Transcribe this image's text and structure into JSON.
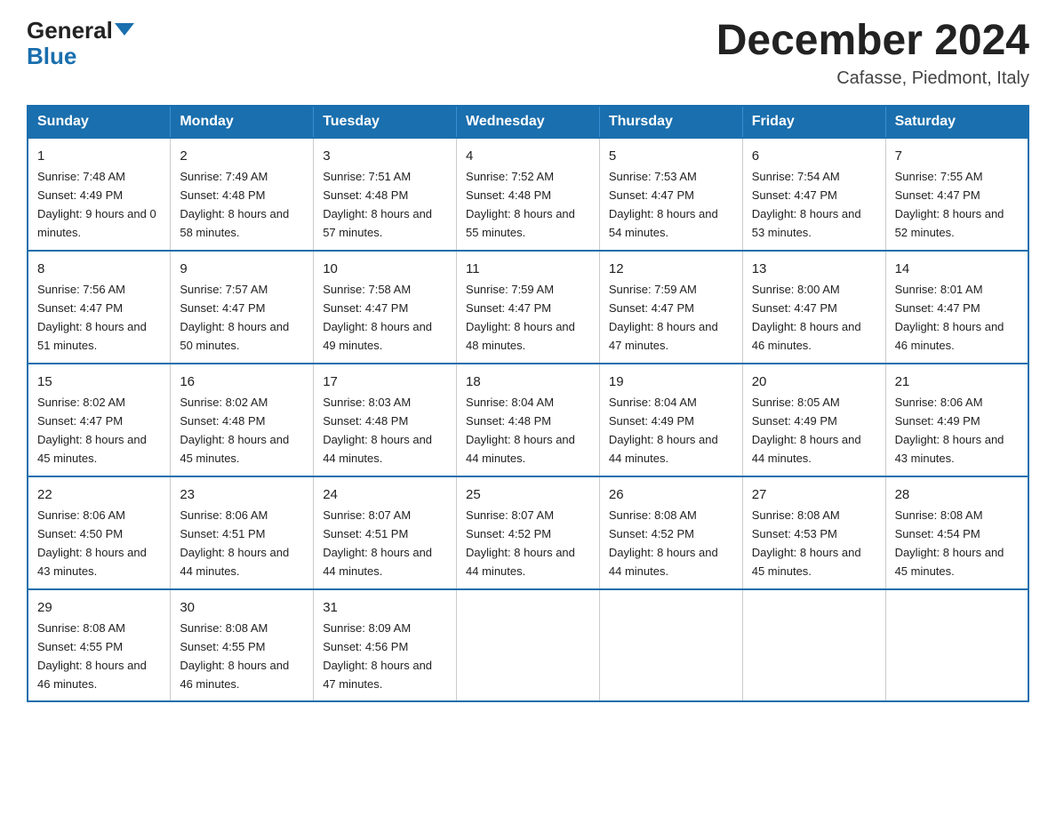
{
  "header": {
    "logo_general": "General",
    "logo_blue": "Blue",
    "month_title": "December 2024",
    "location": "Cafasse, Piedmont, Italy"
  },
  "days_of_week": [
    "Sunday",
    "Monday",
    "Tuesday",
    "Wednesday",
    "Thursday",
    "Friday",
    "Saturday"
  ],
  "weeks": [
    [
      {
        "day": "1",
        "sunrise": "7:48 AM",
        "sunset": "4:49 PM",
        "daylight": "9 hours and 0 minutes."
      },
      {
        "day": "2",
        "sunrise": "7:49 AM",
        "sunset": "4:48 PM",
        "daylight": "8 hours and 58 minutes."
      },
      {
        "day": "3",
        "sunrise": "7:51 AM",
        "sunset": "4:48 PM",
        "daylight": "8 hours and 57 minutes."
      },
      {
        "day": "4",
        "sunrise": "7:52 AM",
        "sunset": "4:48 PM",
        "daylight": "8 hours and 55 minutes."
      },
      {
        "day": "5",
        "sunrise": "7:53 AM",
        "sunset": "4:47 PM",
        "daylight": "8 hours and 54 minutes."
      },
      {
        "day": "6",
        "sunrise": "7:54 AM",
        "sunset": "4:47 PM",
        "daylight": "8 hours and 53 minutes."
      },
      {
        "day": "7",
        "sunrise": "7:55 AM",
        "sunset": "4:47 PM",
        "daylight": "8 hours and 52 minutes."
      }
    ],
    [
      {
        "day": "8",
        "sunrise": "7:56 AM",
        "sunset": "4:47 PM",
        "daylight": "8 hours and 51 minutes."
      },
      {
        "day": "9",
        "sunrise": "7:57 AM",
        "sunset": "4:47 PM",
        "daylight": "8 hours and 50 minutes."
      },
      {
        "day": "10",
        "sunrise": "7:58 AM",
        "sunset": "4:47 PM",
        "daylight": "8 hours and 49 minutes."
      },
      {
        "day": "11",
        "sunrise": "7:59 AM",
        "sunset": "4:47 PM",
        "daylight": "8 hours and 48 minutes."
      },
      {
        "day": "12",
        "sunrise": "7:59 AM",
        "sunset": "4:47 PM",
        "daylight": "8 hours and 47 minutes."
      },
      {
        "day": "13",
        "sunrise": "8:00 AM",
        "sunset": "4:47 PM",
        "daylight": "8 hours and 46 minutes."
      },
      {
        "day": "14",
        "sunrise": "8:01 AM",
        "sunset": "4:47 PM",
        "daylight": "8 hours and 46 minutes."
      }
    ],
    [
      {
        "day": "15",
        "sunrise": "8:02 AM",
        "sunset": "4:47 PM",
        "daylight": "8 hours and 45 minutes."
      },
      {
        "day": "16",
        "sunrise": "8:02 AM",
        "sunset": "4:48 PM",
        "daylight": "8 hours and 45 minutes."
      },
      {
        "day": "17",
        "sunrise": "8:03 AM",
        "sunset": "4:48 PM",
        "daylight": "8 hours and 44 minutes."
      },
      {
        "day": "18",
        "sunrise": "8:04 AM",
        "sunset": "4:48 PM",
        "daylight": "8 hours and 44 minutes."
      },
      {
        "day": "19",
        "sunrise": "8:04 AM",
        "sunset": "4:49 PM",
        "daylight": "8 hours and 44 minutes."
      },
      {
        "day": "20",
        "sunrise": "8:05 AM",
        "sunset": "4:49 PM",
        "daylight": "8 hours and 44 minutes."
      },
      {
        "day": "21",
        "sunrise": "8:06 AM",
        "sunset": "4:49 PM",
        "daylight": "8 hours and 43 minutes."
      }
    ],
    [
      {
        "day": "22",
        "sunrise": "8:06 AM",
        "sunset": "4:50 PM",
        "daylight": "8 hours and 43 minutes."
      },
      {
        "day": "23",
        "sunrise": "8:06 AM",
        "sunset": "4:51 PM",
        "daylight": "8 hours and 44 minutes."
      },
      {
        "day": "24",
        "sunrise": "8:07 AM",
        "sunset": "4:51 PM",
        "daylight": "8 hours and 44 minutes."
      },
      {
        "day": "25",
        "sunrise": "8:07 AM",
        "sunset": "4:52 PM",
        "daylight": "8 hours and 44 minutes."
      },
      {
        "day": "26",
        "sunrise": "8:08 AM",
        "sunset": "4:52 PM",
        "daylight": "8 hours and 44 minutes."
      },
      {
        "day": "27",
        "sunrise": "8:08 AM",
        "sunset": "4:53 PM",
        "daylight": "8 hours and 45 minutes."
      },
      {
        "day": "28",
        "sunrise": "8:08 AM",
        "sunset": "4:54 PM",
        "daylight": "8 hours and 45 minutes."
      }
    ],
    [
      {
        "day": "29",
        "sunrise": "8:08 AM",
        "sunset": "4:55 PM",
        "daylight": "8 hours and 46 minutes."
      },
      {
        "day": "30",
        "sunrise": "8:08 AM",
        "sunset": "4:55 PM",
        "daylight": "8 hours and 46 minutes."
      },
      {
        "day": "31",
        "sunrise": "8:09 AM",
        "sunset": "4:56 PM",
        "daylight": "8 hours and 47 minutes."
      },
      null,
      null,
      null,
      null
    ]
  ]
}
